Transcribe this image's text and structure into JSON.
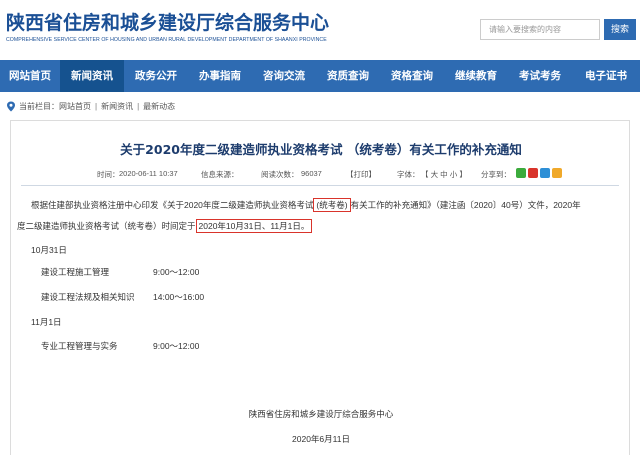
{
  "header": {
    "site_title": "陕西省住房和城乡建设厅综合服务中心",
    "site_subtitle": "COMPREHENSIVE SERVICE CENTER OF HOUSING AND URBAN RURAL DEVELOPMENT DEPARTMENT OF SHAANXI PROVINCE",
    "search_placeholder": "请输入要搜索的内容",
    "search_button": "搜索"
  },
  "nav": {
    "items": [
      {
        "label": "网站首页",
        "active": false
      },
      {
        "label": "新闻资讯",
        "active": true
      },
      {
        "label": "政务公开",
        "active": false
      },
      {
        "label": "办事指南",
        "active": false
      },
      {
        "label": "咨询交流",
        "active": false
      },
      {
        "label": "资质查询",
        "active": false
      },
      {
        "label": "资格查询",
        "active": false
      },
      {
        "label": "继续教育",
        "active": false
      },
      {
        "label": "考试考务",
        "active": false
      },
      {
        "label": "电子证书",
        "active": false
      }
    ]
  },
  "breadcrumb": {
    "prefix": "当前栏目：",
    "items": [
      "网站首页",
      "新闻资讯",
      "最新动态"
    ]
  },
  "article": {
    "title": "关于2020年度二级建造师执业资格考试 （统考卷）有关工作的补充通知",
    "meta": {
      "time_label": "时间：",
      "time_value": "2020-06-11 10:37",
      "source_label": "信息来源：",
      "views_label": "阅读次数：",
      "views_value": "96037",
      "print_label": "【打印】",
      "font_label": "字体：",
      "font_options": "【 大  中  小 】",
      "share_label": "分享到："
    },
    "paragraph": {
      "line1_a": "根据住建部执业资格注册中心印发《关于2020年度二级建造师执业资格考试",
      "line1_hl": "(统考卷)",
      "line1_b": "有关工作的补充通知》（建注函〔2020〕40号）文件，2020年",
      "line2_a": "度二级建造师执业资格考试（统考卷）时间定于",
      "line2_hl": "2020年10月31日、11月1日。"
    },
    "schedule": {
      "day1": "10月31日",
      "day1_items": [
        {
          "subject": "建设工程施工管理",
          "time": "9:00～12:00"
        },
        {
          "subject": "建设工程法规及相关知识",
          "time": "14:00～16:00"
        }
      ],
      "day2": "11月1日",
      "day2_items": [
        {
          "subject": "专业工程管理与实务",
          "time": "9:00～12:00"
        }
      ]
    },
    "signature": {
      "org": "陕西省住房和城乡建设厅综合服务中心",
      "date": "2020年6月11日"
    }
  },
  "colors": {
    "brand_blue": "#2e6bb2",
    "nav_active": "#15528f",
    "highlight_red": "#d9342b"
  },
  "icons": {
    "breadcrumb": "location-pin-icon",
    "share": [
      "wechat-icon",
      "weibo-icon",
      "qq-icon",
      "qzone-icon"
    ]
  }
}
